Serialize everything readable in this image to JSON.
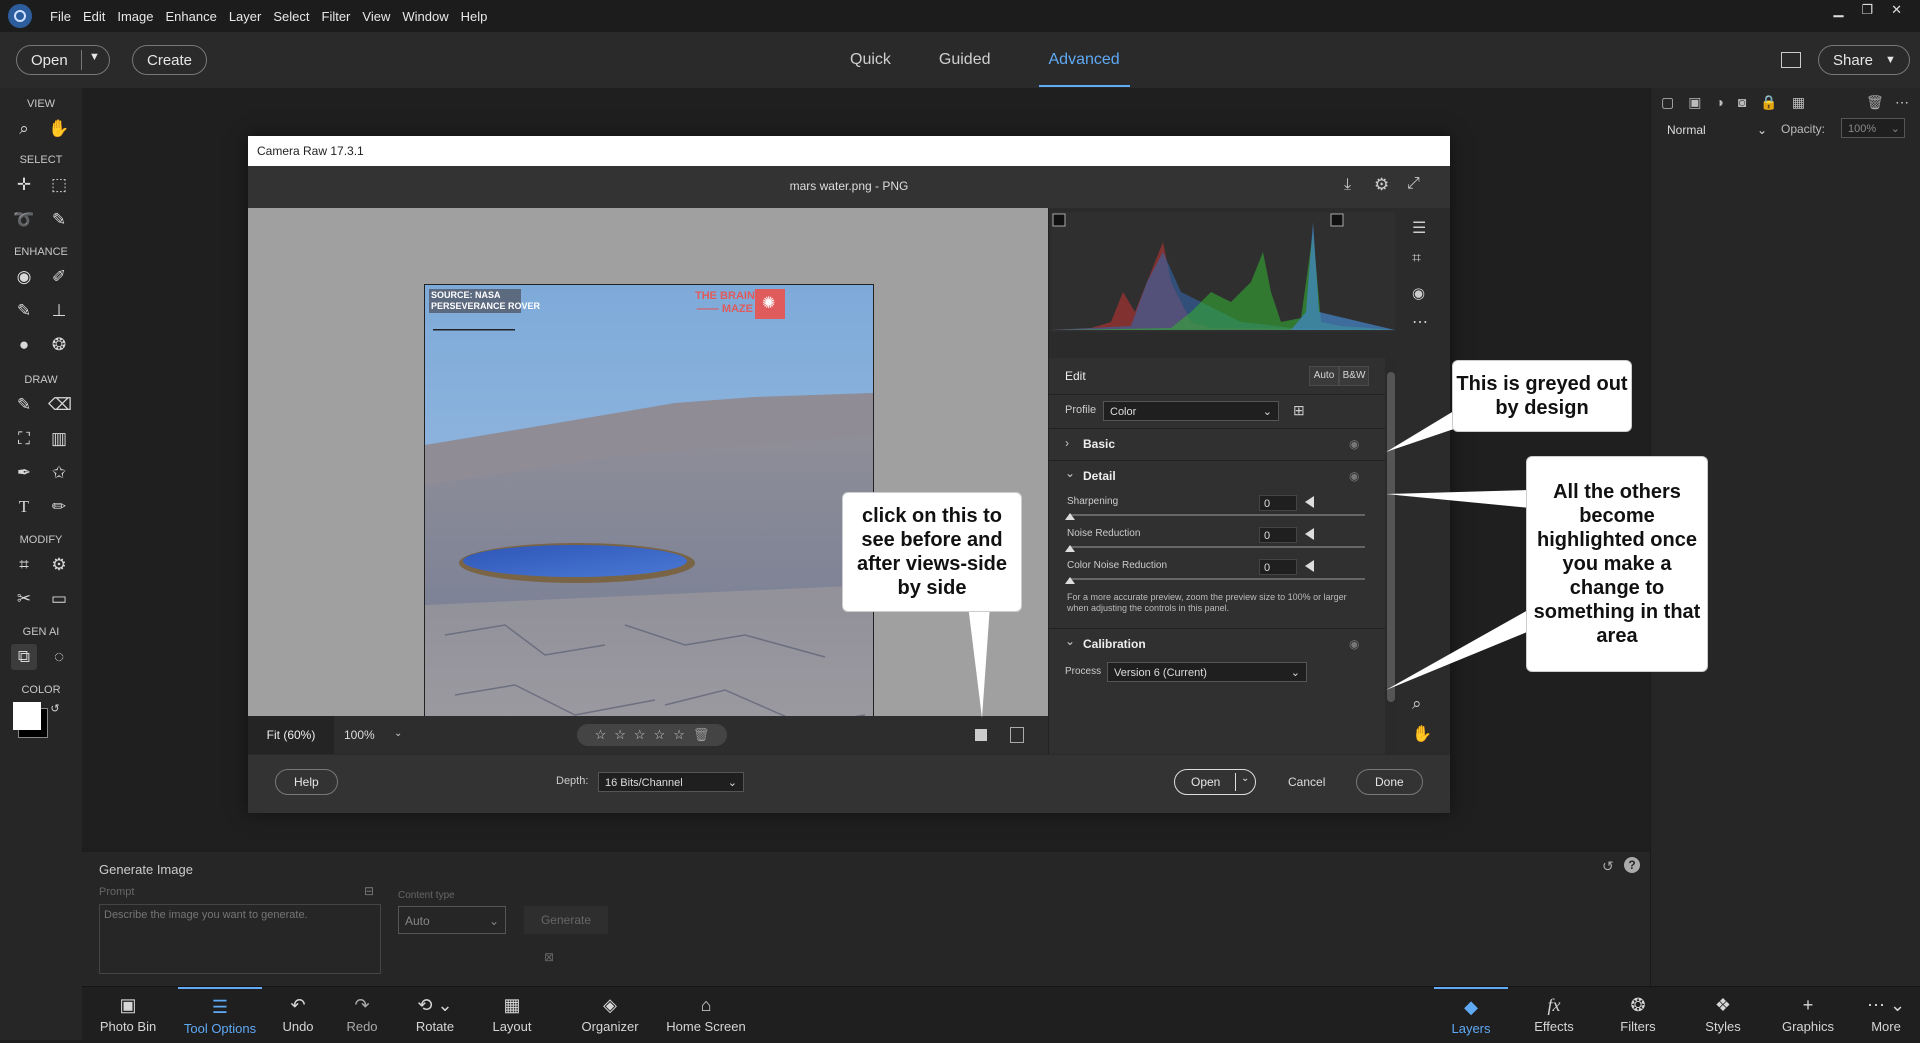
{
  "menu": [
    "File",
    "Edit",
    "Image",
    "Enhance",
    "Layer",
    "Select",
    "Filter",
    "View",
    "Window",
    "Help"
  ],
  "window_controls": {
    "minimize": "▁",
    "restore": "❐",
    "close": "✕"
  },
  "toolbar": {
    "open_label": "Open",
    "create_label": "Create",
    "share_label": "Share"
  },
  "modes": [
    "Quick",
    "Guided",
    "Advanced"
  ],
  "left_panel": {
    "view": "VIEW",
    "select": "SELECT",
    "enhance": "ENHANCE",
    "draw": "DRAW",
    "modify": "MODIFY",
    "gen_ai": "GEN AI",
    "color": "COLOR"
  },
  "right_panel": {
    "blend_mode": "Normal",
    "opacity_label": "Opacity:",
    "opacity_value": "100%"
  },
  "dialog": {
    "title": "Camera Raw 17.3.1",
    "filename": "mars water.png  -  PNG",
    "photo_source": "SOURCE: NASA\nPERSEVERANCE ROVER",
    "photo_brand": "THE BRAIN\n—— MAZE",
    "fit_label": "Fit (60%)",
    "zoom_label": "100%",
    "edit_label": "Edit",
    "auto_label": "Auto",
    "bw_label": "B&W",
    "profile_label": "Profile",
    "profile_value": "Color",
    "basic_label": "Basic",
    "detail_label": "Detail",
    "sharpening_label": "Sharpening",
    "sharpening_value": "0",
    "noise_label": "Noise Reduction",
    "noise_value": "0",
    "color_noise_label": "Color Noise Reduction",
    "color_noise_value": "0",
    "preview_note": "For a more accurate preview, zoom the preview size to 100% or larger when adjusting the controls in this panel.",
    "calibration_label": "Calibration",
    "process_label": "Process",
    "process_value": "Version 6 (Current)",
    "help_label": "Help",
    "depth_label": "Depth:",
    "depth_value": "16 Bits/Channel",
    "open_label": "Open",
    "cancel_label": "Cancel",
    "done_label": "Done"
  },
  "callouts": {
    "greyed": "This is greyed out by design",
    "highlighted": "All the others become highlighted once you make a change to something in that area",
    "before_after": "click on this to see before and after views-side by side"
  },
  "generate": {
    "title": "Generate Image",
    "prompt_label": "Prompt",
    "prompt_placeholder": "Describe the image you want to generate.",
    "content_type_label": "Content type",
    "content_type_value": "Auto",
    "generate_label": "Generate"
  },
  "bottom": [
    "Photo Bin",
    "Tool Options",
    "Undo",
    "Redo",
    "Rotate",
    "Layout",
    "Organizer",
    "Home Screen",
    "Layers",
    "Effects",
    "Filters",
    "Styles",
    "Graphics",
    "More"
  ]
}
